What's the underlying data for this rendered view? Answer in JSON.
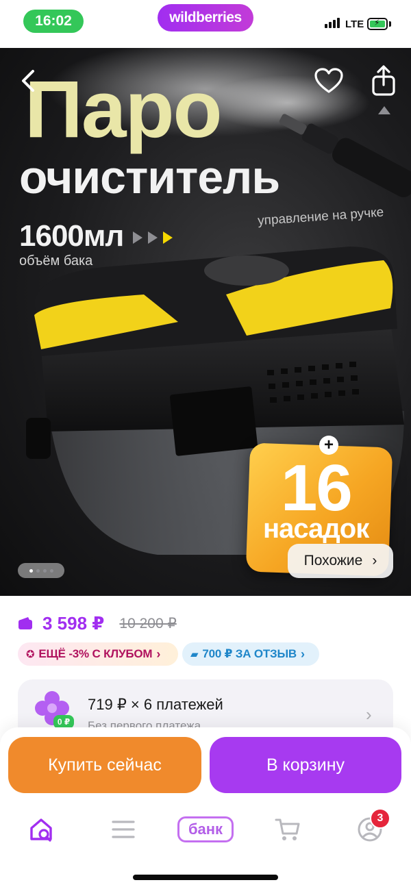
{
  "status_bar": {
    "time": "16:02",
    "brand": "wildberries",
    "network": "LTE",
    "time_pill_color": "#34c759",
    "brand_color": "#a12ef0"
  },
  "hero": {
    "title_line1": "Паро",
    "title_line2": "очиститель",
    "volume": "1600мл",
    "volume_caption": "объём бака",
    "handle_caption": "управление на ручке",
    "badge_number": "16",
    "badge_text": "насадок",
    "badge_plus": "+",
    "similar_label": "Похожие",
    "similar_chevron": "›",
    "icons": [
      "back-chevron-icon",
      "heart-icon",
      "share-icon",
      "scroll-up-icon"
    ],
    "gallery_page": 1,
    "gallery_total": 4
  },
  "price": {
    "current": "3 598 ₽",
    "old": "10 200 ₽",
    "accent_color": "#a12ef0"
  },
  "chips": {
    "club": "ЕЩЁ -3% С КЛУБОМ",
    "review": "700 ₽ ЗА ОТЗЫВ",
    "chevron": "›"
  },
  "installment": {
    "title": "719 ₽ × 6 платежей",
    "subtitle": "Без первого платежа",
    "badge": "0 ₽",
    "chevron": "›"
  },
  "actions": {
    "buy_now": "Купить сейчас",
    "to_cart": "В корзину",
    "buy_color": "#f08a2c",
    "cart_color": "#a73af0"
  },
  "tab_bar": {
    "bank_label": "банк",
    "profile_badge_count": "3",
    "tabs": [
      "home-search-icon",
      "catalog-menu-icon",
      "bank",
      "cart-icon",
      "profile-icon"
    ]
  }
}
